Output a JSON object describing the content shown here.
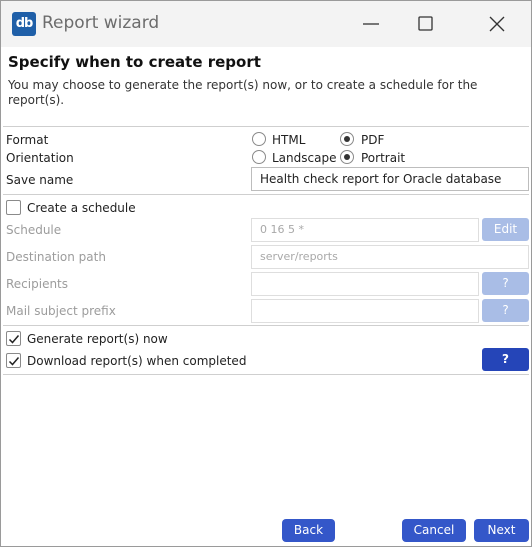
{
  "window": {
    "app_icon_text": "db",
    "title": "Report wizard"
  },
  "header": {
    "heading": "Specify when to create report",
    "description": "You may choose to generate the report(s) now, or to create a schedule for the report(s)."
  },
  "format": {
    "label": "Format",
    "options": [
      "HTML",
      "PDF"
    ],
    "selected": "PDF"
  },
  "orientation": {
    "label": "Orientation",
    "options": [
      "Landscape",
      "Portrait"
    ],
    "selected": "Portrait"
  },
  "save_name": {
    "label": "Save name",
    "value": "Health check report for Oracle database"
  },
  "schedule_section": {
    "create_schedule_label": "Create a schedule",
    "create_schedule_checked": false,
    "schedule_label": "Schedule",
    "schedule_value": "0 16 5 *",
    "edit_button": "Edit",
    "destination_label": "Destination path",
    "destination_value": "server/reports",
    "recipients_label": "Recipients",
    "recipients_value": "",
    "recipients_help": "?",
    "mail_subject_label": "Mail subject prefix",
    "mail_subject_value": "",
    "mail_subject_help": "?"
  },
  "options": {
    "generate_now_label": "Generate report(s) now",
    "generate_now_checked": true,
    "download_label": "Download report(s) when completed",
    "download_checked": true,
    "download_help": "?"
  },
  "footer": {
    "back": "Back",
    "cancel": "Cancel",
    "next": "Next"
  },
  "colors": {
    "primary_button": "#3457c9",
    "disabled_button": "#a9bde6",
    "app_icon": "#1f5fa8"
  }
}
